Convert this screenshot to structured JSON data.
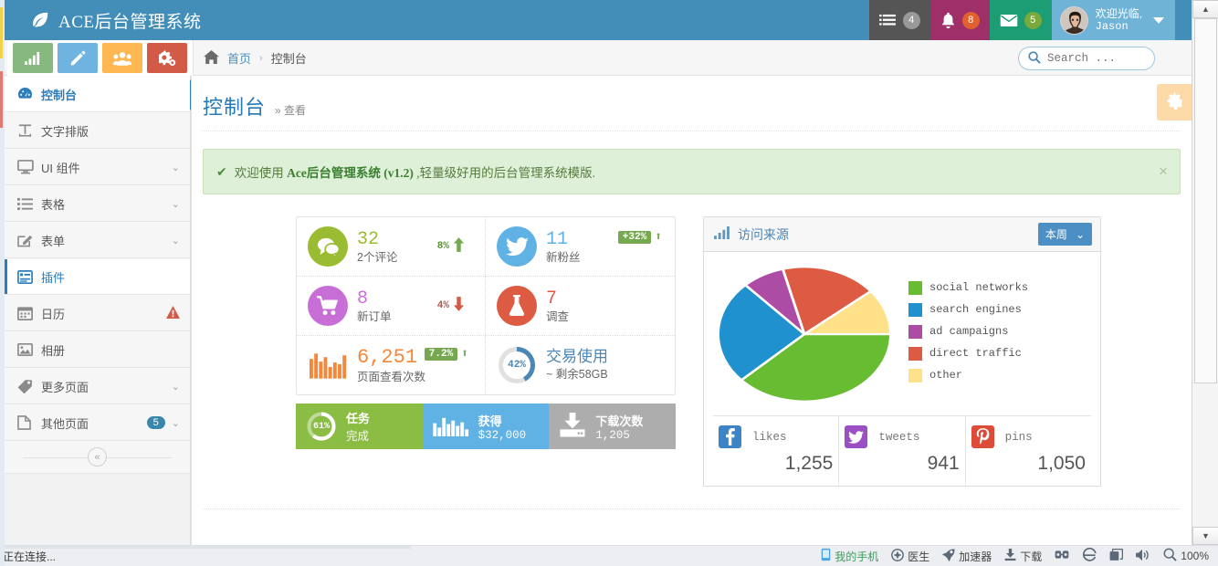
{
  "navbar": {
    "brand": "ACE后台管理系统",
    "brand_icon": "leaf-icon",
    "tasks": {
      "icon": "tasks-icon",
      "count": "4"
    },
    "notifications": {
      "icon": "bell-icon",
      "count": "8"
    },
    "messages": {
      "icon": "envelope-icon",
      "count": "5"
    },
    "user": {
      "greeting": "欢迎光临,",
      "name": "Jason",
      "avatar": "user-avatar"
    },
    "colors": {
      "bar": "#438eb9",
      "tasks": "#555555",
      "bell": "#9e2f68",
      "mail": "#1d9d74",
      "user": "#6fb3d6"
    }
  },
  "shortcuts": [
    {
      "name": "chart-shortcut",
      "icon": "bar-chart-icon",
      "color": "#87b87f"
    },
    {
      "name": "edit-shortcut",
      "icon": "pencil-icon",
      "color": "#6fb3e0"
    },
    {
      "name": "group-shortcut",
      "icon": "users-icon",
      "color": "#ffb752"
    },
    {
      "name": "settings-shortcut",
      "icon": "cogs-icon",
      "color": "#d15b47"
    }
  ],
  "breadcrumb": {
    "home_icon": "home-icon",
    "home": "首页",
    "separator": "›",
    "current": "控制台"
  },
  "search": {
    "placeholder": "Search ...",
    "value": "",
    "icon": "search-icon"
  },
  "sidebar": {
    "items": [
      {
        "label": "控制台",
        "icon": "dashboard-icon",
        "state": "active",
        "chevron": "",
        "badge": "",
        "warn": false
      },
      {
        "label": "文字排版",
        "icon": "text-width-icon",
        "state": "",
        "chevron": "",
        "badge": "",
        "warn": false
      },
      {
        "label": "UI 组件",
        "icon": "desktop-icon",
        "state": "",
        "chevron": "⌄",
        "badge": "",
        "warn": false
      },
      {
        "label": "表格",
        "icon": "list-icon",
        "state": "",
        "chevron": "⌄",
        "badge": "",
        "warn": false
      },
      {
        "label": "表单",
        "icon": "edit-square-icon",
        "state": "",
        "chevron": "⌄",
        "badge": "",
        "warn": false
      },
      {
        "label": "插件",
        "icon": "plugin-icon",
        "state": "current",
        "chevron": "",
        "badge": "",
        "warn": false
      },
      {
        "label": "日历",
        "icon": "calendar-icon",
        "state": "",
        "chevron": "",
        "badge": "",
        "warn": true
      },
      {
        "label": "相册",
        "icon": "picture-icon",
        "state": "",
        "chevron": "",
        "badge": "",
        "warn": false
      },
      {
        "label": "更多页面",
        "icon": "tag-icon",
        "state": "",
        "chevron": "⌄",
        "badge": "",
        "warn": false
      },
      {
        "label": "其他页面",
        "icon": "file-icon",
        "state": "",
        "chevron": "⌄",
        "badge": "5",
        "warn": false
      }
    ],
    "collapse": {
      "icon": "double-chevron-left-icon",
      "label": "«"
    }
  },
  "page": {
    "title": "控制台",
    "subtitle": "» 查看",
    "settings_icon": "gear-icon"
  },
  "alert": {
    "check_icon": "check-icon",
    "text_prefix": "欢迎使用 ",
    "text_bold": "Ace后台管理系统 (v1.2)",
    "text_suffix": " ,轻量级好用的后台管理系统模版.",
    "close_icon": "close-icon"
  },
  "infoboxes": [
    {
      "icon": "comments-icon",
      "icon_color": "#9abc32",
      "number": "32",
      "label": "2个评论",
      "trend": "8%",
      "trend_dir": "up",
      "trend_style": "plain"
    },
    {
      "icon": "twitter-icon",
      "icon_color": "#61b2e4",
      "number": "11",
      "label": "新粉丝",
      "trend": "+32%",
      "trend_dir": "up",
      "trend_style": "pill"
    },
    {
      "icon": "cart-icon",
      "icon_color": "#c86ed7",
      "number": "8",
      "label": "新订单",
      "trend": "4%",
      "trend_dir": "down",
      "trend_style": "plain"
    },
    {
      "icon": "flask-icon",
      "icon_color": "#dd5a43",
      "number": "7",
      "label": "调查",
      "trend": "",
      "trend_dir": "",
      "trend_style": "none"
    },
    {
      "icon": "bars-icon",
      "icon_color": "#f89406",
      "number": "6,251",
      "label": "页面查看次数",
      "trend": "7.2%",
      "trend_dir": "up",
      "trend_style": "pill"
    },
    {
      "icon": "donut-icon",
      "icon_color": "#4b86b4",
      "number": "交易使用",
      "label": "~ 剩余58GB",
      "trend": "",
      "trend_dir": "",
      "trend_style": "donut",
      "percent": "42%",
      "percent_value": 42
    }
  ],
  "strip": [
    {
      "icon": "donut-ring-icon",
      "percent": "61%",
      "title": "任务",
      "value": "完成",
      "color": "#8bbc44"
    },
    {
      "icon": "sparkline-icon",
      "title": "获得",
      "value": "$32,000",
      "color": "#61b2e4"
    },
    {
      "icon": "download-icon",
      "title": "下载次数",
      "value": "1,205",
      "color": "#adadad"
    }
  ],
  "widget": {
    "icon": "signal-icon",
    "title": "访问来源",
    "period": "本周",
    "period_caret": "⌄"
  },
  "chart_data": {
    "type": "pie",
    "title": "访问来源",
    "labels": [
      "social networks",
      "search engines",
      "ad campaigns",
      "direct traffic",
      "other"
    ],
    "values": [
      38,
      25,
      8,
      18,
      11
    ],
    "colors": [
      "#68bc31",
      "#2091cf",
      "#ad4ca4",
      "#dd5a43",
      "#fee188"
    ],
    "legend_position": "right",
    "grid": false
  },
  "social": [
    {
      "icon": "facebook-icon",
      "icon_color": "#3b84c8",
      "label": "likes",
      "value": "1,255"
    },
    {
      "icon": "twitter-icon",
      "icon_color": "#9b4fc4",
      "label": "tweets",
      "value": "941"
    },
    {
      "icon": "pinterest-icon",
      "icon_color": "#dd4b39",
      "label": "pins",
      "value": "1,050"
    }
  ],
  "statusbar": {
    "left": "正在连接...",
    "items": [
      {
        "icon": "phone-icon",
        "label": "我的手机",
        "style": "green"
      },
      {
        "icon": "doctor-icon",
        "label": "医生",
        "style": ""
      },
      {
        "icon": "rocket-icon",
        "label": "加速器",
        "style": ""
      },
      {
        "icon": "download-icon",
        "label": "下载",
        "style": ""
      },
      {
        "icon": "glasses-icon",
        "label": "",
        "style": ""
      },
      {
        "icon": "ie-icon",
        "label": "",
        "style": ""
      },
      {
        "icon": "windows-icon",
        "label": "",
        "style": ""
      },
      {
        "icon": "volume-icon",
        "label": "",
        "style": ""
      },
      {
        "icon": "zoom-icon",
        "label": "100%",
        "style": ""
      }
    ]
  },
  "scrollbar": {
    "up": "▲",
    "down": "▼"
  }
}
